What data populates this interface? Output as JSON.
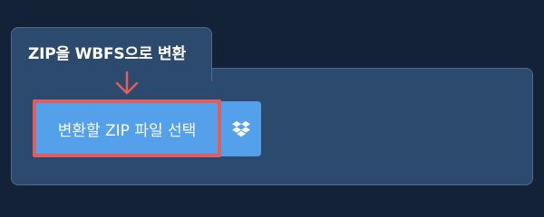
{
  "panel": {
    "title": "ZIP을 WBFS으로 변환"
  },
  "convert_button": {
    "label": "변환할 ZIP 파일 선택"
  },
  "dropbox_button": {
    "icon": "dropbox-icon"
  },
  "highlight": {
    "arrow_icon": "arrow-down-icon",
    "color": "#df5e5e"
  },
  "colors": {
    "page_background": "#132236",
    "panel_background": "#2c4a6e",
    "button_background": "#54a0ea"
  }
}
